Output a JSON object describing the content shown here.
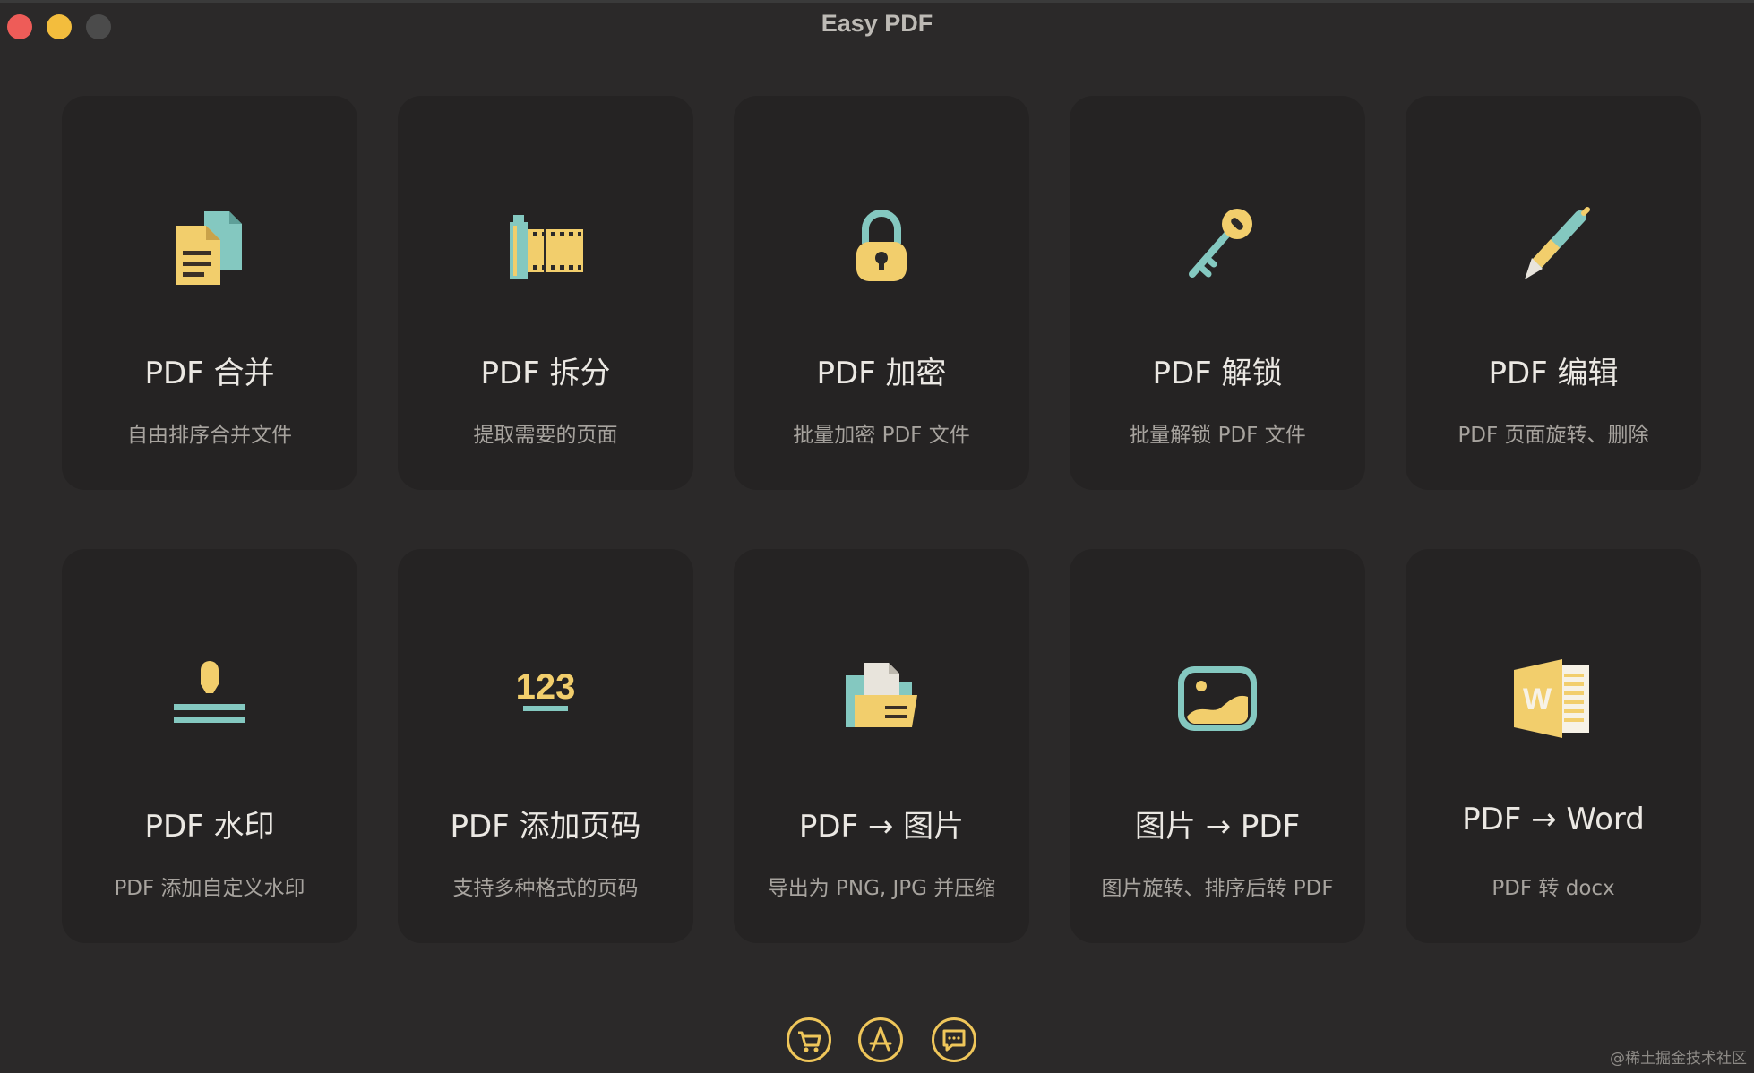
{
  "window": {
    "title": "Easy PDF"
  },
  "colors": {
    "background": "#2b2929",
    "card": "#252323",
    "accent_yellow": "#f2ce6c",
    "accent_teal": "#84c8c0",
    "title_text": "#ebe8e3",
    "desc_text": "#a7a39e"
  },
  "tools": [
    {
      "title": "PDF 合并",
      "desc": "自由排序合并文件",
      "icon": "merge-files-icon"
    },
    {
      "title": "PDF 拆分",
      "desc": "提取需要的页面",
      "icon": "film-split-icon"
    },
    {
      "title": "PDF 加密",
      "desc": "批量加密 PDF 文件",
      "icon": "padlock-icon"
    },
    {
      "title": "PDF 解锁",
      "desc": "批量解锁 PDF 文件",
      "icon": "key-icon"
    },
    {
      "title": "PDF 编辑",
      "desc": "PDF 页面旋转、删除",
      "icon": "pen-icon"
    },
    {
      "title": "PDF 水印",
      "desc": "PDF 添加自定义水印",
      "icon": "stamp-icon",
      "icon_text": ""
    },
    {
      "title": "PDF 添加页码",
      "desc": "支持多种格式的页码",
      "icon": "page-number-icon",
      "icon_text": "123"
    },
    {
      "title": "PDF → 图片",
      "desc": "导出为 PNG, JPG 并压缩",
      "icon": "folder-document-icon"
    },
    {
      "title": "图片 → PDF",
      "desc": "图片旋转、排序后转 PDF",
      "icon": "image-icon"
    },
    {
      "title": "PDF → Word",
      "desc": "PDF 转 docx",
      "icon": "word-icon",
      "icon_text": "W"
    }
  ],
  "footer": {
    "buttons": [
      {
        "icon": "cart-icon"
      },
      {
        "icon": "app-store-icon"
      },
      {
        "icon": "feedback-icon"
      }
    ]
  },
  "watermark": "@稀土掘金技术社区"
}
